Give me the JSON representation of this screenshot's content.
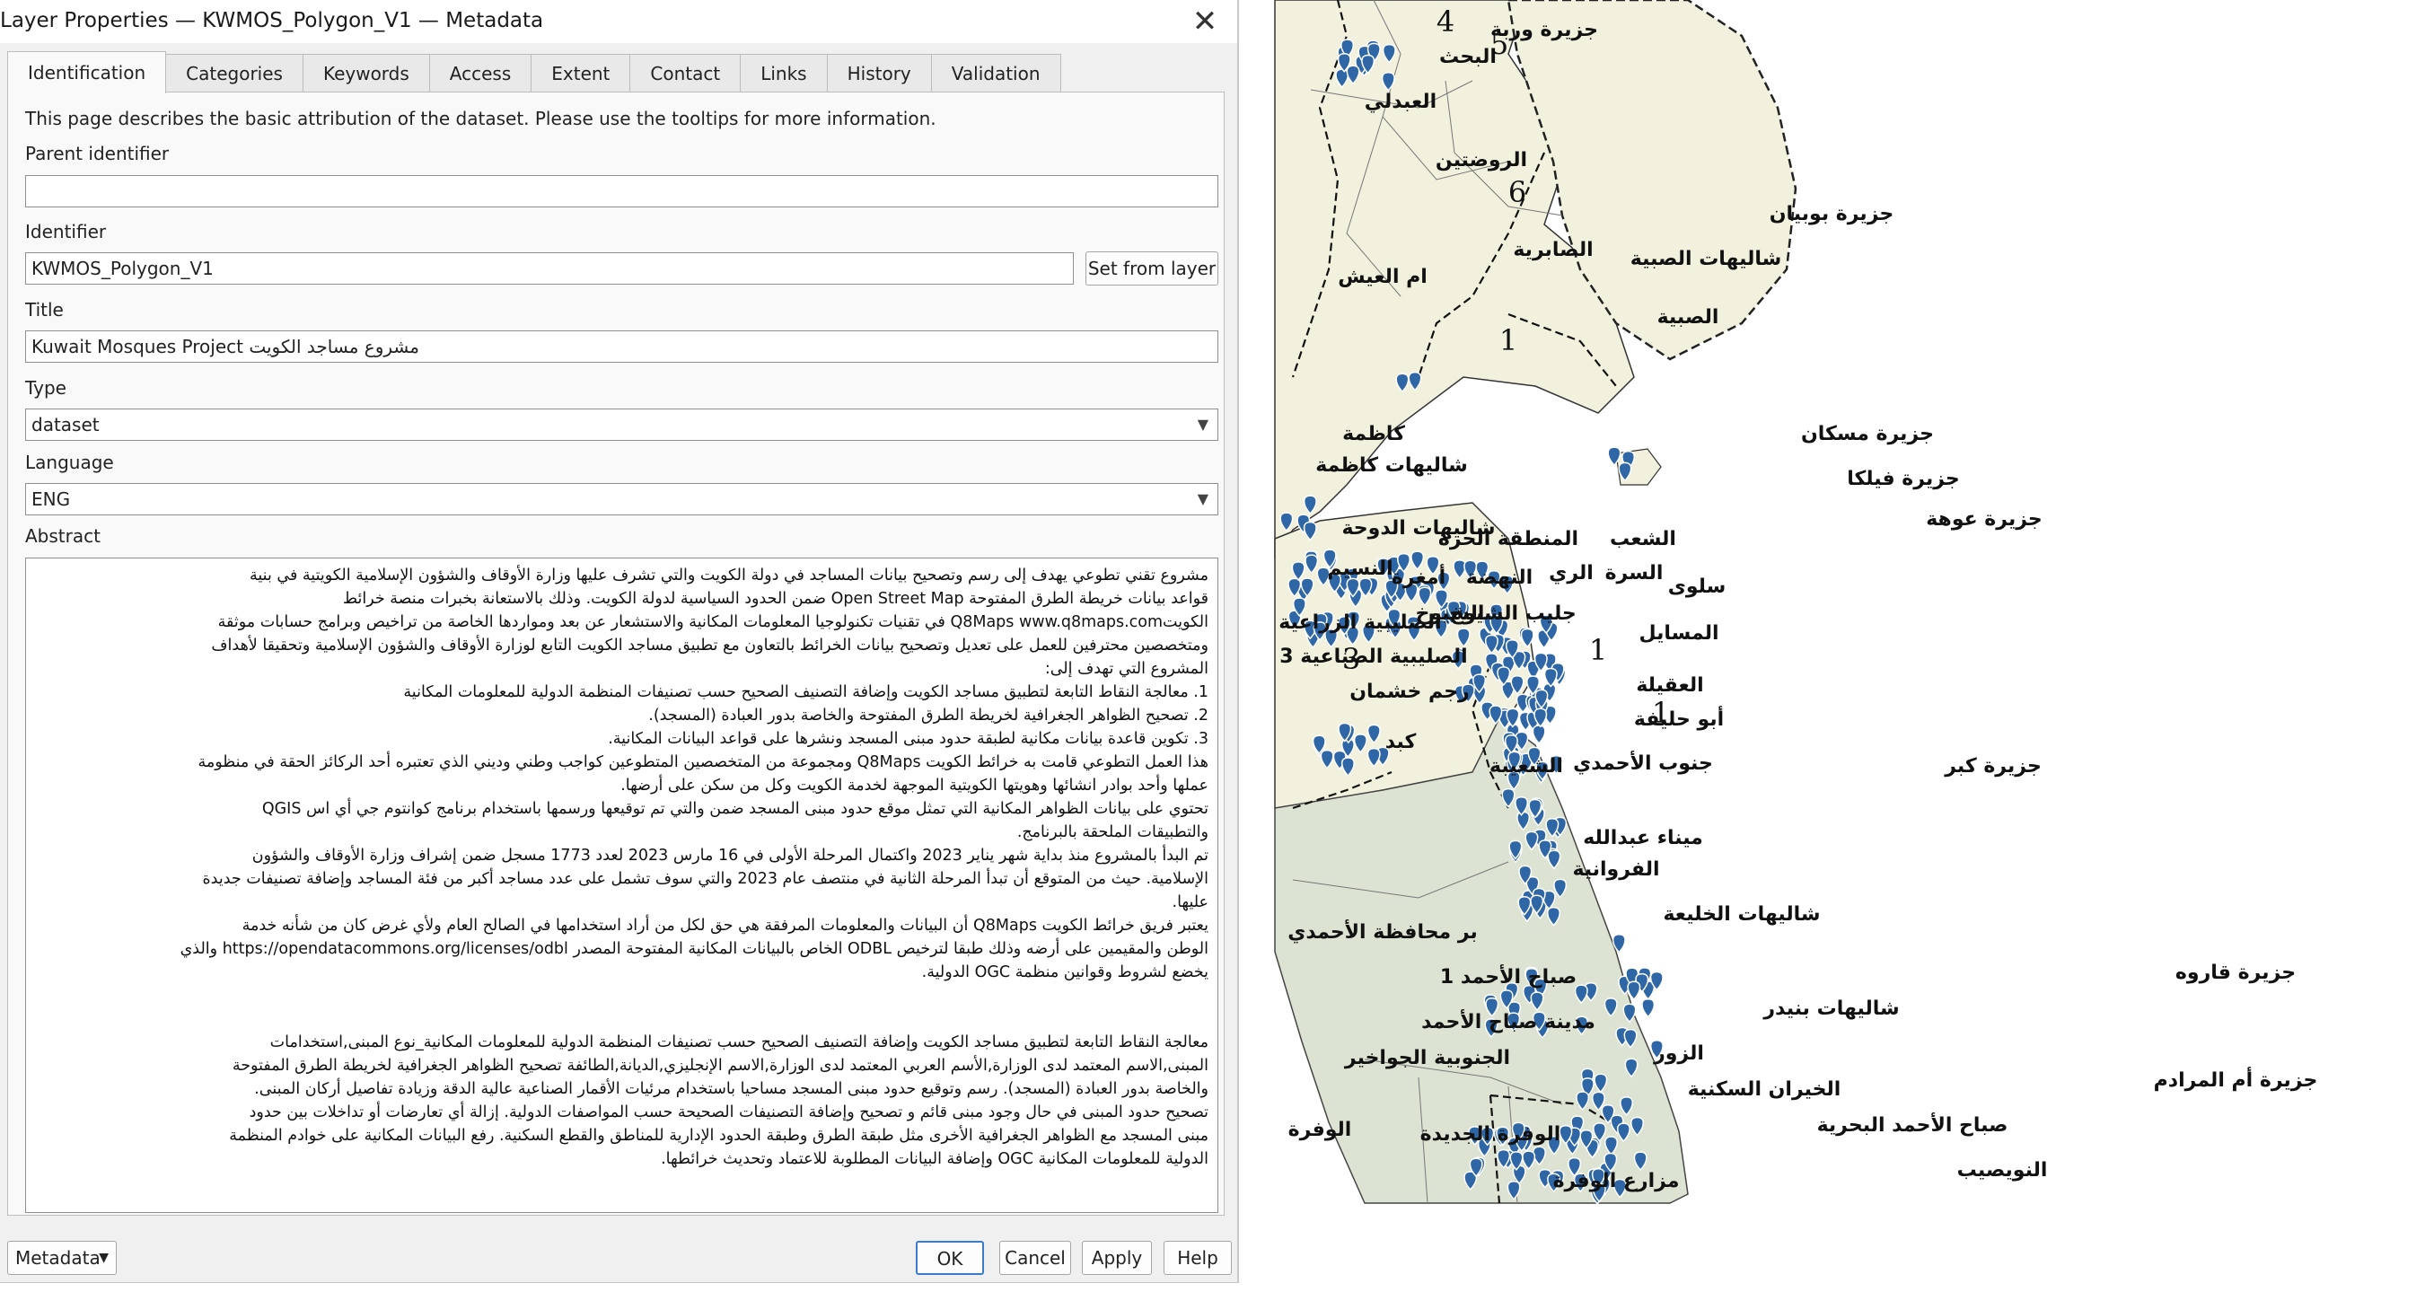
{
  "window": {
    "title": "Layer Properties — KWMOS_Polygon_V1 — Metadata",
    "close_icon": "close-icon"
  },
  "tabs": [
    "Identification",
    "Categories",
    "Keywords",
    "Access",
    "Extent",
    "Contact",
    "Links",
    "History",
    "Validation"
  ],
  "identification": {
    "intro": "This page describes the basic attribution of the dataset. Please use the tooltips for more information.",
    "parent_identifier_label": "Parent identifier",
    "parent_identifier_value": "",
    "identifier_label": "Identifier",
    "identifier_value": "KWMOS_Polygon_V1",
    "set_from_layer_label": "Set from layer",
    "title_label": "Title",
    "title_value": "Kuwait Mosques Project مشروع مساجد الكويت",
    "type_label": "Type",
    "type_value": "dataset",
    "language_label": "Language",
    "language_value": "ENG",
    "abstract_label": "Abstract",
    "abstract_lines": [
      "مشروع تقني تطوعي يهدف إلى رسم وتصحيح بيانات المساجد في دولة الكويت والتي تشرف عليها وزارة الأوقاف والشؤون الإسلامية الكويتية في بنية",
      "قواعد بيانات خريطة الطرق المفتوحة Open Street Map ضمن الحدود السياسية لدولة الكويت. وذلك بالاستعانة بخبرات منصة خرائط",
      "الكويتQ8Maps www.q8maps.com في تقنيات تكنولوجيا المعلومات المكانية والاستشعار عن بعد ومواردها الخاصة من تراخيص وبرامج حسابات موثقة",
      "ومتخصصين محترفين للعمل على تعديل وتصحيح بيانات الخرائط بالتعاون مع تطبيق مساجد الكويت التابع لوزارة الأوقاف والشؤون الإسلامية وتحقيقا لأهداف",
      "المشروع التي تهدف إلى:",
      "1. معالجة النقاط التابعة لتطبيق مساجد الكويت وإضافة التصنيف الصحيح حسب تصنيفات المنظمة الدولية للمعلومات المكانية",
      "2. تصحيح الظواهر الجغرافية لخريطة الطرق المفتوحة والخاصة بدور العبادة (المسجد).",
      "3. تكوين قاعدة بيانات مكانية لطبقة حدود مبنى المسجد ونشرها على قواعد البيانات المكانية.",
      "هذا العمل التطوعي قامت به خرائط الكويت Q8Maps ومجموعة من المتخصصين المتطوعين كواجب وطني وديني الذي تعتبره أحد الركائز الحقة في منظومة",
      "عملها وأحد بوادر انشائها وهويتها الكويتية الموجهة لخدمة الكويت وكل من سكن على أرضها.",
      "تحتوي على بيانات الظواهر المكانية التي تمثل موقع حدود مبنى المسجد ضمن والتي تم توقيعها ورسمها باستخدام برنامج كوانتوم جي أي اس QGIS",
      "والتطبيقات الملحقة بالبرنامج.",
      "تم البدأ بالمشروع منذ بداية شهر يناير 2023 واكتمال المرحلة الأولى في 16 مارس 2023 لعدد 1773 مسجل ضمن إشراف وزارة الأوقاف والشؤون",
      "الإسلامية. حيث من المتوقع أن تبدأ المرحلة الثانية في منتصف عام 2023 والتي سوف تشمل على عدد مساجد أكبر من فئة المساجد وإضافة تصنيفات جديدة",
      "عليها.",
      "يعتبر فريق خرائط الكويت Q8Maps أن البيانات والمعلومات المرفقة هي حق لكل من أراد استخدامها في الصالح العام ولأي غرض كان من شأنه خدمة",
      "الوطن والمقيمين على أرضه وذلك طبقا لترخيص ODBL الخاص بالبيانات المكانية المفتوحة المصدر https://opendatacommons.org/licenses/odbl والذي",
      "يخضع لشروط وقوانين منظمة OGC الدولية.",
      "",
      "",
      "معالجة النقاط التابعة لتطبيق مساجد الكويت وإضافة التصنيف الصحيح حسب تصنيفات المنظمة الدولية للمعلومات المكانية_نوع المبنى,استخدامات",
      "المبنى,الاسم المعتمد لدى الوزارة,الأسم العربي المعتمد لدى الوزارة,الاسم الإنجليزي,الديانة,الطائفة تصحيح الظواهر الجغرافية لخريطة الطرق المفتوحة",
      "والخاصة بدور العبادة (المسجد). رسم وتوقيع حدود مبنى المسجد مساحيا باستخدام مرئيات الأقمار الصناعية عالية الدقة وزيادة تفاصيل أركان المبنى.",
      "تصحيح حدود المبنى في حال وجود مبنى قائم و تصحيح وإضافة التصنيفات الصحيحة حسب المواصفات الدولية. إزالة أي تعارضات أو تداخلات بين حدود",
      "مبنى المسجد مع الظواهر الجغرافية الأخرى مثل طبقة الطرق وطبقة الحدود الإدارية للمناطق والقطع السكنية. رفع البيانات المكانية على خوادم المنظمة",
      "الدولية للمعلومات المكانية OGC وإضافة البيانات المطلوبة للاعتماد وتحديث خرائطها."
    ]
  },
  "footer": {
    "metadata_combo": "Metadata",
    "ok": "OK",
    "cancel": "Cancel",
    "apply": "Apply",
    "help": "Help"
  },
  "map": {
    "colors": {
      "land": "#f2f1de",
      "ahmadi": "#dde3d2",
      "mosque_marker": "#2f66a5",
      "boundary": "#222222"
    },
    "labels": [
      "جزيرة وربة",
      "البحث",
      "العبدلي",
      "الروضتين",
      "جزيرة بوبيان",
      "الصابرية",
      "شاليهات الصبية",
      "ام العيش",
      "الصبية",
      "كاظمة",
      "شاليهات كاظمة",
      "جزيرة مسكان",
      "جزيرة فيلكا",
      "جزيرة عوهة",
      "شاليهات الدوحة",
      "الشعب",
      "المنطقة الحرة",
      "النسيم",
      "السرة",
      "الري",
      "النهضة",
      "أمغرة",
      "سلوى",
      "الصليبية الزراعية",
      "جليب الشيوخ",
      "الشيوخ",
      "المسايل",
      "الصليبية الصناعية 3",
      "العقيلة",
      "رجم خشمان",
      "أبو حليفة",
      "كبد",
      "جنوب الأحمدي",
      "الشعيبة",
      "جزيرة كبر",
      "ميناء عبدالله",
      "الفروانية",
      "شاليهات الخليعة",
      "بر محافظة الأحمدي",
      "جزيرة قاروه",
      "صباح الأحمد 1",
      "شاليهات بنيدر",
      "مدينة صباح الأحمد",
      "الجنوبية الجواخير",
      "الزور",
      "جزيرة أم المرادم",
      "الخيران السكنية",
      "صباح الأحمد البحرية",
      "الوفرة",
      "الوفرة الجديدة",
      "مزارع الوفرة",
      "النويصيب"
    ],
    "zone_numbers": [
      "4",
      "5",
      "6",
      "1",
      "1",
      "3",
      "1"
    ]
  }
}
